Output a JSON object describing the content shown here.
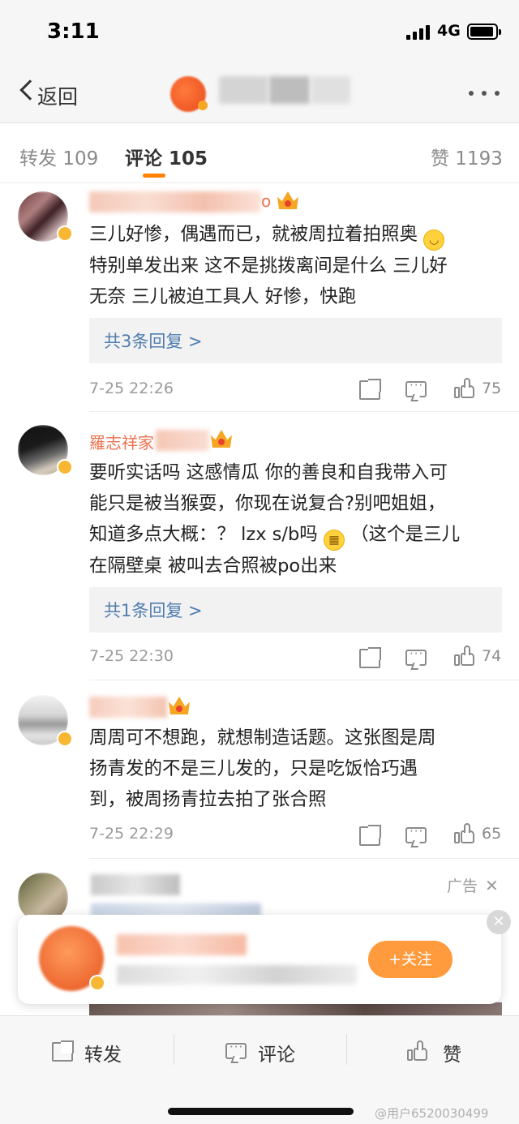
{
  "status_bar": {
    "time": "3:11",
    "network": "4G"
  },
  "nav": {
    "back_label": "返回"
  },
  "tabs": [
    {
      "label": "转发 109"
    },
    {
      "label": "评论 105"
    },
    {
      "label": "赞 1193"
    }
  ],
  "accent_color": "#ff8200",
  "comments": [
    {
      "user": "o",
      "text_lines": [
        "三儿好惨，偶遇而已，就被周拉着拍照奥",
        "特别单发出来 这不是挑拨离间是什么 三儿好",
        "无奈 三儿被迫工具人 好惨，快跑"
      ],
      "reply_link": "共3条回复 >",
      "time": "7-25 22:26",
      "likes": "75"
    },
    {
      "user": "羅志祥家",
      "text_lines": [
        "要听实话吗 这感情瓜 你的善良和自我带入可",
        "能只是被当猴耍，你现在说复合?别吧姐姐，",
        "知道多点大概：？ lzx s/b吗",
        "（这个是三儿",
        "在隔壁桌 被叫去合照被po出来"
      ],
      "reply_link": "共1条回复 >",
      "time": "7-25 22:30",
      "likes": "74"
    },
    {
      "user": "",
      "text_lines": [
        "周周可不想跑，就想制造话题。这张图是周",
        "扬青发的不是三儿发的，只是吃饭恰巧遇",
        "到，被周扬青拉去拍了张合照"
      ],
      "time": "7-25 22:29",
      "likes": "65"
    }
  ],
  "ad": {
    "label": "广告",
    "close": "✕"
  },
  "follow_card": {
    "close": "✕",
    "button": "+关注"
  },
  "bottom_bar": {
    "repost": "转发",
    "comment": "评论",
    "like": "赞"
  },
  "watermark": "@用户6520030499"
}
